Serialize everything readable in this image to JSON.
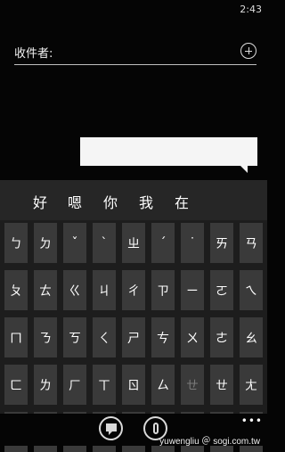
{
  "status": {
    "time": "2:43"
  },
  "compose": {
    "recipient_label": "收件者:"
  },
  "keyboard": {
    "candidates": [
      "好",
      "嗯",
      "你",
      "我",
      "在"
    ],
    "rows": [
      [
        "ㄅ",
        "ㄉ",
        "ˇ",
        "ˋ",
        "ㄓ",
        "ˊ",
        "˙",
        "ㄞ",
        "ㄢ"
      ],
      [
        "ㄆ",
        "ㄊ",
        "ㄍ",
        "ㄐ",
        "ㄔ",
        "ㄗ",
        "ㄧ",
        "ㄛ",
        "ㄟ"
      ],
      [
        "ㄇ",
        "ㄋ",
        "ㄎ",
        "ㄑ",
        "ㄕ",
        "ㄘ",
        "ㄨ",
        "ㄜ",
        "ㄠ"
      ],
      [
        "ㄈ",
        "ㄌ",
        "ㄏ",
        "ㄒ",
        "ㄖ",
        "ㄙ",
        "ㄩ",
        "ㄝ",
        "ㄤ"
      ]
    ],
    "bottom_row": {
      "symbols": "&12",
      "comma": "，",
      "period": "。",
      "er": "ㄦ",
      "traditional": "繁"
    },
    "dim_key": "ㄝ"
  },
  "app_bar": {
    "more": "•••",
    "watermark": "yuwengliu ＠ sogi.com.tw"
  }
}
